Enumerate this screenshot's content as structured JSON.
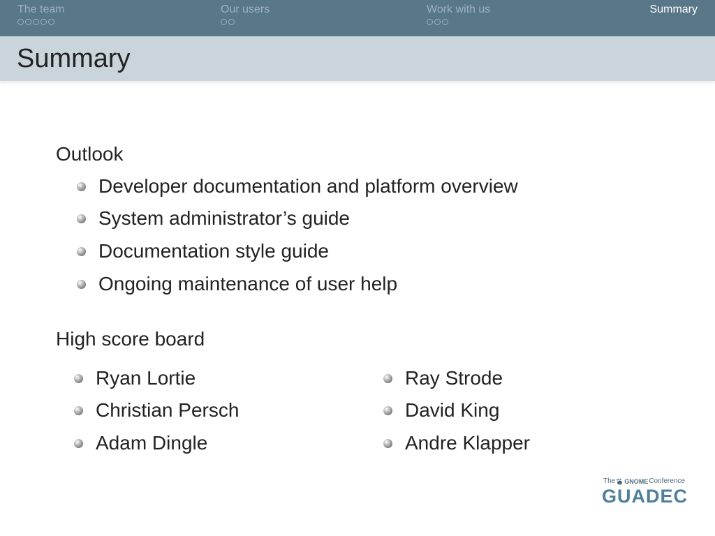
{
  "nav": {
    "sections": [
      {
        "title": "The team",
        "dots": 5,
        "active": false
      },
      {
        "title": "Our users",
        "dots": 2,
        "active": false
      },
      {
        "title": "Work with us",
        "dots": 3,
        "active": false
      },
      {
        "title": "Summary",
        "dots": 0,
        "active": true
      }
    ]
  },
  "frame": {
    "title": "Summary"
  },
  "outlook": {
    "heading": "Outlook",
    "items": [
      "Developer documentation and platform overview",
      "System administrator’s guide",
      "Documentation style guide",
      "Ongoing maintenance of user help"
    ]
  },
  "scoreboard": {
    "heading": "High score board",
    "left": [
      "Ryan Lortie",
      "Christian Persch",
      "Adam Dingle"
    ],
    "right": [
      "Ray Strode",
      "David King",
      "Andre Klapper"
    ]
  },
  "logo": {
    "prefix": "The",
    "gnome": "GNOME",
    "suffix": "Conference",
    "name": "GUADEC"
  },
  "colors": {
    "navbar": "#587789",
    "titlebar": "#c9d5db",
    "logo": "#4d7f99"
  }
}
